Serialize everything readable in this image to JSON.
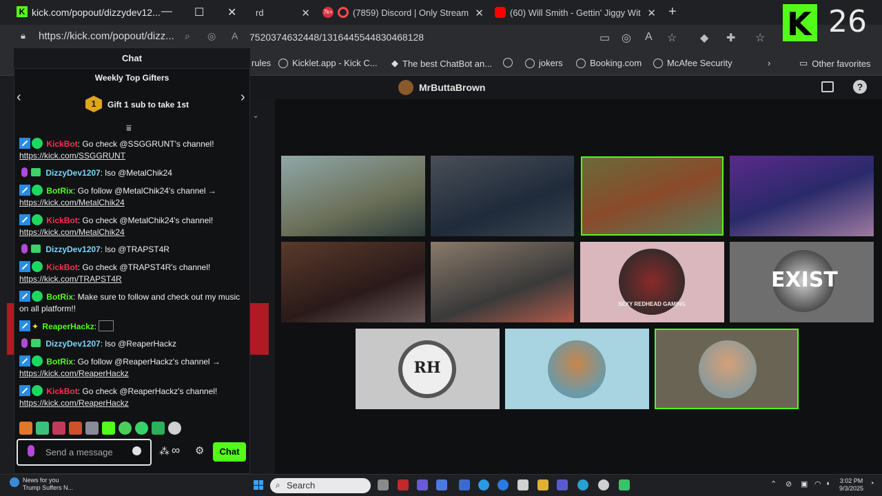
{
  "browser": {
    "tabs": [
      {
        "label": "rd"
      },
      {
        "label": "(7859) Discord | Only Stream",
        "badge": "7k+"
      },
      {
        "label": "(60) Will Smith - Gettin' Jiggy Wit"
      }
    ],
    "url": "7520374632448/1316445544830468128",
    "bookmarks": [
      {
        "label": "rules"
      },
      {
        "label": "Kicklet.app - Kick C..."
      },
      {
        "label": "The best ChatBot an..."
      },
      {
        "label": "jokers"
      },
      {
        "label": "Booking.com"
      },
      {
        "label": "McAfee Security"
      }
    ],
    "other_favorites": "Other favorites"
  },
  "overlay": {
    "logo_letter": "K",
    "number": "26"
  },
  "stream": {
    "streamer": "MrButtaBrown",
    "tiles": [
      {
        "label": "camera-1"
      },
      {
        "label": "camera-2"
      },
      {
        "label": "camera-3"
      },
      {
        "label": "camera-4"
      },
      {
        "label": "camera-5"
      },
      {
        "label": "camera-6"
      },
      {
        "label": "SEXY REDHEAD GAMING"
      },
      {
        "label": "EXIST"
      },
      {
        "label": "RH"
      },
      {
        "label": "camera-10"
      },
      {
        "label": "camera-11"
      }
    ]
  },
  "popout": {
    "title": "kick.com/popout/dizzydev12...",
    "url": "https://kick.com/popout/dizz...",
    "chat_title": "Chat",
    "gifters_title": "Weekly Top Gifters",
    "gift_rank": "1",
    "gift_text": "Gift 1 sub to take 1st",
    "messages": [
      {
        "user": "KickBot",
        "text": ": Go check @SSGGRUNT's channel!",
        "link": "https://kick.com/SSGGRUNT"
      },
      {
        "user": "DizzyDev1207",
        "text": ": lso @MetalChik24",
        "link": ""
      },
      {
        "user": "BotRix",
        "text": ": Go follow @MetalChik24's channel →",
        "link": "https://kick.com/MetalChik24"
      },
      {
        "user": "KickBot",
        "text": ": Go check @MetalChik24's channel!",
        "link": "https://kick.com/MetalChik24"
      },
      {
        "user": "DizzyDev1207",
        "text": ": lso @TRAPST4R",
        "link": ""
      },
      {
        "user": "KickBot",
        "text": ": Go check @TRAPST4R's channel!",
        "link": "https://kick.com/TRAPST4R"
      },
      {
        "user": "BotRix",
        "text": ": Make sure to follow and check out my music on all platform!!",
        "link": ""
      },
      {
        "user": "ReaperHackz",
        "text": ":",
        "link": ""
      },
      {
        "user": "DizzyDev1207",
        "text": ": lso @ReaperHackz",
        "link": ""
      },
      {
        "user": "BotRix",
        "text": ": Go follow @ReaperHackz's channel →",
        "link": "https://kick.com/ReaperHackz"
      },
      {
        "user": "KickBot",
        "text": ": Go check @ReaperHackz's channel!",
        "link": "https://kick.com/ReaperHackz"
      }
    ],
    "input_placeholder": "Send a message",
    "chat_button": "Chat",
    "colors": {
      "kickbot": "#ff2d55",
      "botrix": "#53fc18",
      "dizzy": "#7ad7ff",
      "reaper": "#53fc18",
      "accent": "#53fc18"
    }
  },
  "taskbar": {
    "news_title": "News for you",
    "news_sub": "Trump Suffers N...",
    "search": "Search",
    "time": "3:02 PM",
    "date": "9/3/2025"
  }
}
